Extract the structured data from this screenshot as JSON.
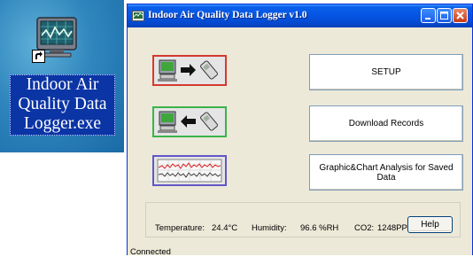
{
  "desktop": {
    "shortcut_label_lines": [
      "Indoor Air",
      "Quality Data",
      "Logger.exe"
    ]
  },
  "window": {
    "title": "Indoor Air Quality Data Logger v1.0"
  },
  "buttons": {
    "setup": "SETUP",
    "download": "Download Records",
    "graphic": "Graphic&Chart Analysis for Saved Data",
    "help": "Help"
  },
  "readings": {
    "temperature_label": "Temperature:",
    "temperature_value": "24.4°C",
    "humidity_label": "Humidity:",
    "humidity_value": "96.6 %RH",
    "co2_label": "CO2:",
    "co2_value": "1248PPM"
  },
  "status": {
    "text": "Connected"
  },
  "colors": {
    "setup_panel_border": "#d43a2f",
    "download_panel_border": "#3ab34a",
    "chart_panel_border": "#6257c6",
    "titlebar": "#0554e3",
    "desktop_label_bg": "#0b34a5"
  },
  "icons": {
    "shortcut": "monitor-chart-icon",
    "shortcut_overlay": "shortcut-arrow-icon",
    "setup": "computer-to-logger-icon",
    "download": "logger-to-computer-icon",
    "chart": "line-chart-icon"
  }
}
